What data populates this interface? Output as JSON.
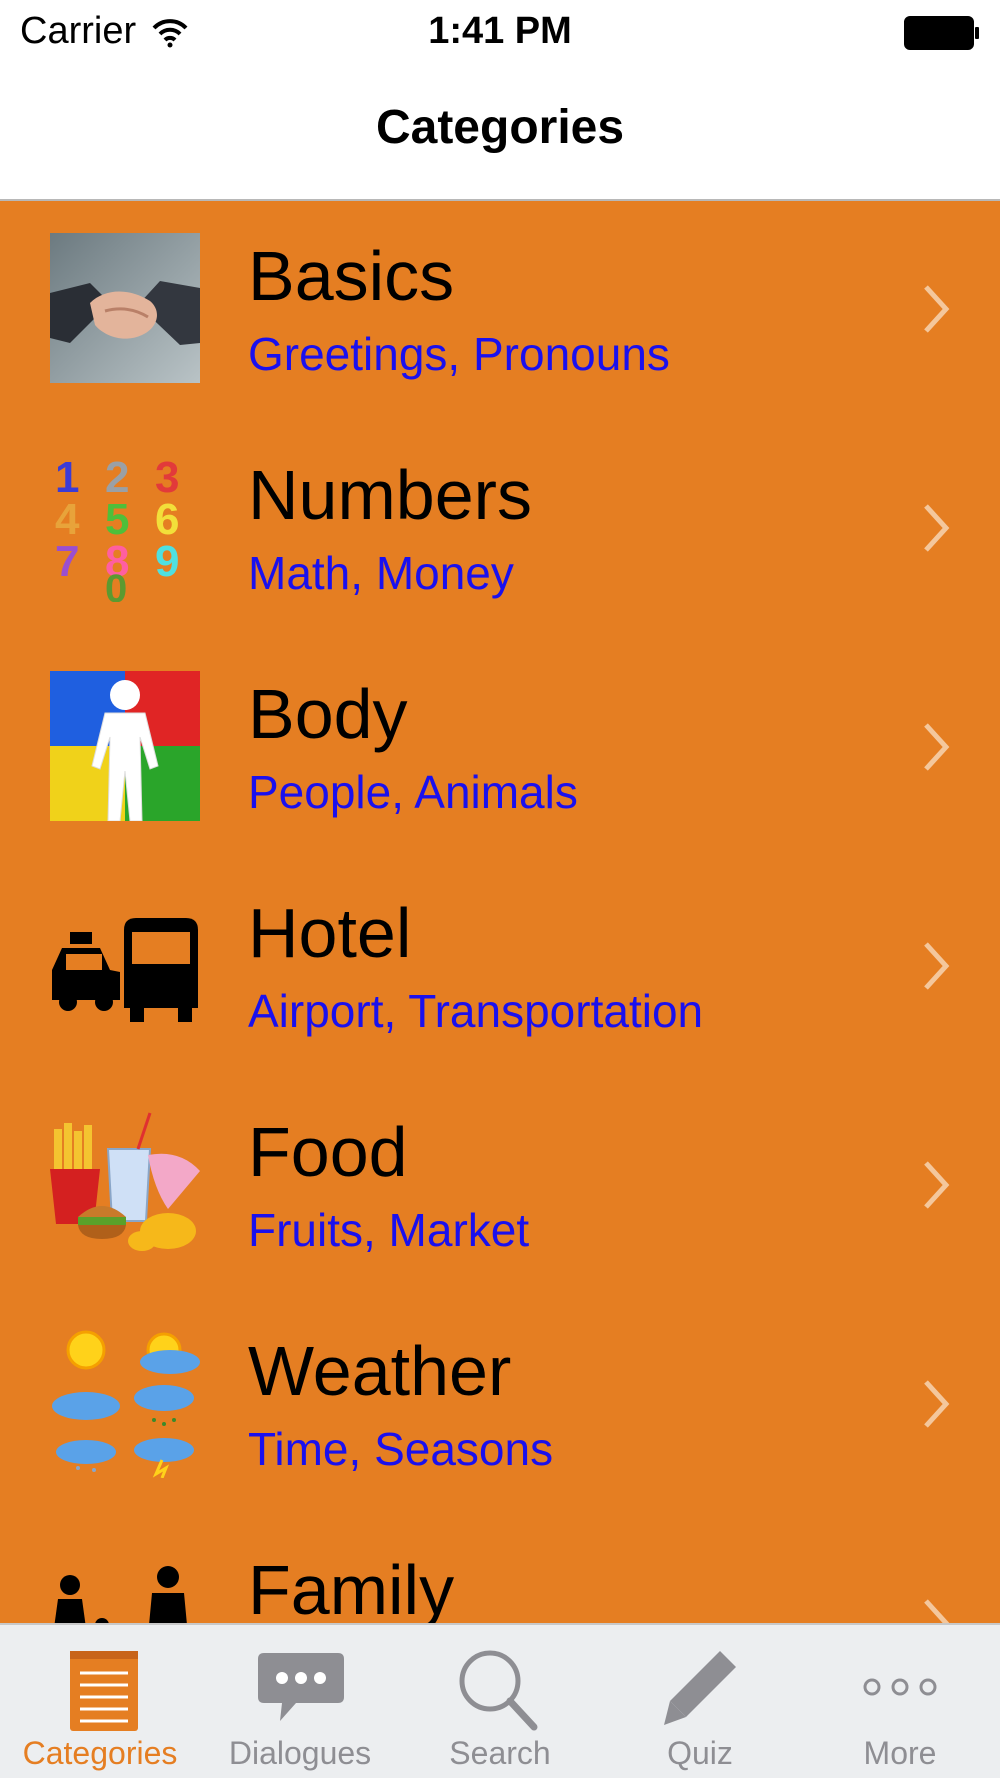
{
  "status_bar": {
    "carrier": "Carrier",
    "time": "1:41 PM"
  },
  "nav": {
    "title": "Categories"
  },
  "categories": [
    {
      "title": "Basics",
      "subtitle": "Greetings, Pronouns"
    },
    {
      "title": "Numbers",
      "subtitle": "Math, Money"
    },
    {
      "title": "Body",
      "subtitle": "People, Animals"
    },
    {
      "title": "Hotel",
      "subtitle": "Airport, Transportation"
    },
    {
      "title": "Food",
      "subtitle": "Fruits, Market"
    },
    {
      "title": "Weather",
      "subtitle": "Time, Seasons"
    },
    {
      "title": "Family",
      "subtitle": ""
    }
  ],
  "tabs": [
    {
      "label": "Categories",
      "icon": "notepad-icon",
      "active": true
    },
    {
      "label": "Dialogues",
      "icon": "chat-bubble-icon",
      "active": false
    },
    {
      "label": "Search",
      "icon": "magnifier-icon",
      "active": false
    },
    {
      "label": "Quiz",
      "icon": "pencil-icon",
      "active": false
    },
    {
      "label": "More",
      "icon": "more-dots-icon",
      "active": false
    }
  ],
  "colors": {
    "list_background": "#e57e22",
    "subtitle": "#1a10ee",
    "tab_active": "#e57e22",
    "tab_inactive": "#8e8e93"
  }
}
